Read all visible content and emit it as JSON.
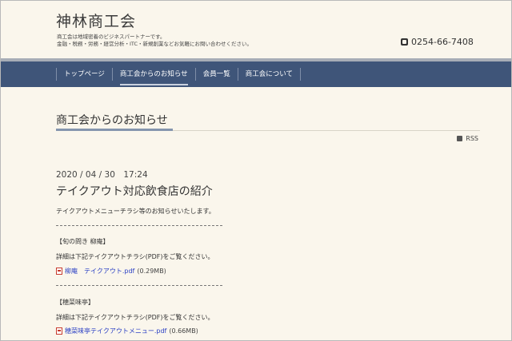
{
  "site": {
    "title": "神林商工会",
    "tagline_line1": "商工会は地域密着のビジネスパートナーです。",
    "tagline_line2": "金融・税務・労務・経営分析・ITC・新規創業などお気軽にお問い合わせください。",
    "phone": "0254-66-7408"
  },
  "nav": {
    "items": [
      {
        "label": "トップページ"
      },
      {
        "label": "商工会からのお知らせ"
      },
      {
        "label": "会員一覧"
      },
      {
        "label": "商工会について"
      }
    ]
  },
  "page": {
    "title": "商工会からのお知らせ",
    "rss_label": "RSS"
  },
  "post": {
    "date": "2020 / 04 / 30　17:24",
    "title": "テイクアウト対応飲食店の紹介",
    "lead": "テイクアウトメニューチラシ等のお知らせいたします。",
    "sections": [
      {
        "heading": "【旬の問き 柳庵】",
        "text": "詳細は下記テイクアウトチラシ(PDF)をご覧ください。",
        "file_name": "柳庵　テイクアウト.pdf",
        "file_size": "(0.29MB)"
      },
      {
        "heading": "【穂菜味亭】",
        "text": "詳細は下記テイクアウトチラシ(PDF)をご覧ください。",
        "file_name": "穂菜味亭テイクアウトメニュー.pdf",
        "file_size": "(0.66MB)"
      }
    ]
  },
  "colors": {
    "background": "#faf6ec",
    "nav": "#3f5579",
    "link": "#2a3fc4",
    "pdf": "#c73b2e"
  }
}
